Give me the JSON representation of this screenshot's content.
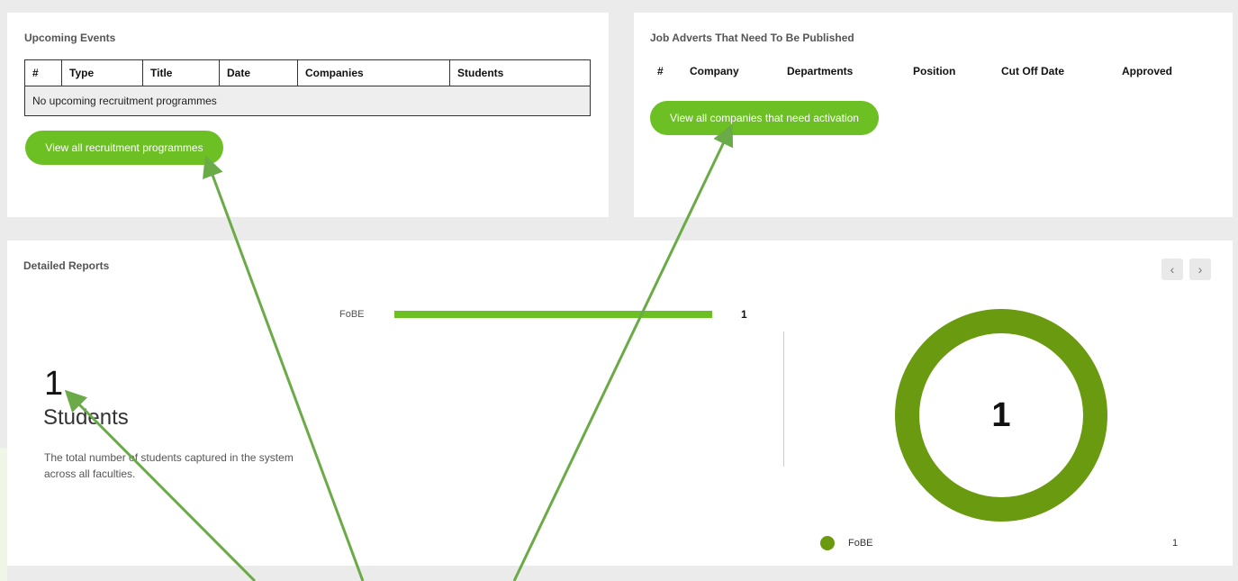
{
  "events": {
    "title": "Upcoming Events",
    "columns": [
      "#",
      "Type",
      "Title",
      "Date",
      "Companies",
      "Students"
    ],
    "empty_message": "No upcoming recruitment programmes",
    "button_label": "View all recruitment programmes"
  },
  "jobs": {
    "title": "Job Adverts That Need To Be Published",
    "columns": [
      "#",
      "Company",
      "Departments",
      "Position",
      "Cut Off Date",
      "Approved"
    ],
    "button_label": "View all companies that need activation"
  },
  "reports": {
    "title": "Detailed Reports",
    "prev_icon": "‹",
    "next_icon": "›",
    "count": "1",
    "count_label": "Students",
    "description": "The total number of students captured in the system across all faculties.",
    "bar": {
      "label": "FoBE",
      "value": "1",
      "fraction": 1.0
    },
    "donut": {
      "value": "1"
    },
    "legend": {
      "label": "FoBE",
      "value": "1"
    }
  },
  "colors": {
    "accent": "#6cc024",
    "donut": "#6a9a10",
    "annotation": "#6aab47"
  },
  "icons": {
    "prev": "chevron-left-icon",
    "next": "chevron-right-icon"
  }
}
